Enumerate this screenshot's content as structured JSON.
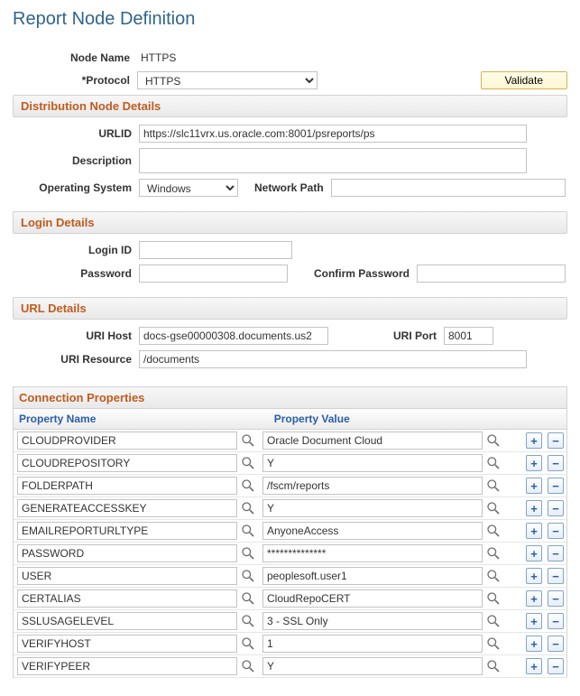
{
  "title": "Report Node Definition",
  "header": {
    "node_name_label": "Node Name",
    "node_name_value": "HTTPS",
    "protocol_label": "*Protocol",
    "protocol_value": "HTTPS",
    "protocol_options": [
      "HTTPS"
    ],
    "validate_button": "Validate"
  },
  "dist": {
    "section_title": "Distribution Node Details",
    "urlid_label": "URLID",
    "urlid_value": "https://slc11vrx.us.oracle.com:8001/psreports/ps",
    "description_label": "Description",
    "description_value": "",
    "os_label": "Operating System",
    "os_value": "Windows",
    "os_options": [
      "Windows"
    ],
    "network_path_label": "Network Path",
    "network_path_value": ""
  },
  "login": {
    "section_title": "Login Details",
    "login_id_label": "Login ID",
    "login_id_value": "",
    "password_label": "Password",
    "password_value": "",
    "confirm_label": "Confirm Password",
    "confirm_value": ""
  },
  "url": {
    "section_title": "URL Details",
    "uri_host_label": "URI Host",
    "uri_host_value": "docs-gse00000308.documents.us2",
    "uri_port_label": "URI Port",
    "uri_port_value": "8001",
    "uri_resource_label": "URI Resource",
    "uri_resource_value": "/documents"
  },
  "grid": {
    "title": "Connection Properties",
    "col_name": "Property Name",
    "col_value": "Property Value",
    "rows": [
      {
        "name": "CLOUDPROVIDER",
        "value": "Oracle Document Cloud"
      },
      {
        "name": "CLOUDREPOSITORY",
        "value": "Y"
      },
      {
        "name": "FOLDERPATH",
        "value": "/fscm/reports"
      },
      {
        "name": "GENERATEACCESSKEY",
        "value": "Y"
      },
      {
        "name": "EMAILREPORTURLTYPE",
        "value": "AnyoneAccess"
      },
      {
        "name": "PASSWORD",
        "value": "**************"
      },
      {
        "name": "USER",
        "value": "peoplesoft.user1"
      },
      {
        "name": "CERTALIAS",
        "value": "CloudRepoCERT"
      },
      {
        "name": "SSLUSAGELEVEL",
        "value": "3 - SSL Only"
      },
      {
        "name": "VERIFYHOST",
        "value": "1"
      },
      {
        "name": "VERIFYPEER",
        "value": "Y"
      }
    ]
  }
}
